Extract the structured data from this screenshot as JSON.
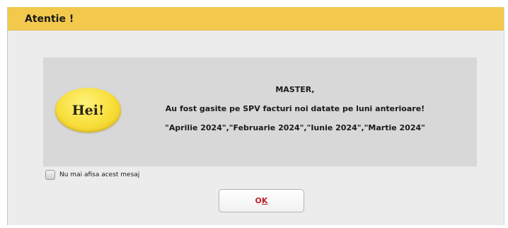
{
  "dialog": {
    "title": "Atentie !",
    "badge_text": "Hei!",
    "message_lines": [
      "MASTER,",
      "Au fost gasite pe SPV facturi noi datate pe luni anterioare!",
      "\"Aprilie 2024\",\"Februarie 2024\",\"Iunie 2024\",\"Martie 2024\""
    ],
    "checkbox": {
      "label": "Nu mai afisa acest mesaj",
      "checked": false
    },
    "ok_button": {
      "label_prefix": "O",
      "label_mnemonic": "K"
    }
  },
  "colors": {
    "title_bar": "#f2c94c",
    "dialog_background": "#ececec",
    "message_panel": "#d8d8d8",
    "badge": "#f8de3a",
    "ok_text": "#c0202a"
  },
  "icons": {
    "badge": "hei-badge-icon",
    "checkbox": "checkbox-icon"
  }
}
